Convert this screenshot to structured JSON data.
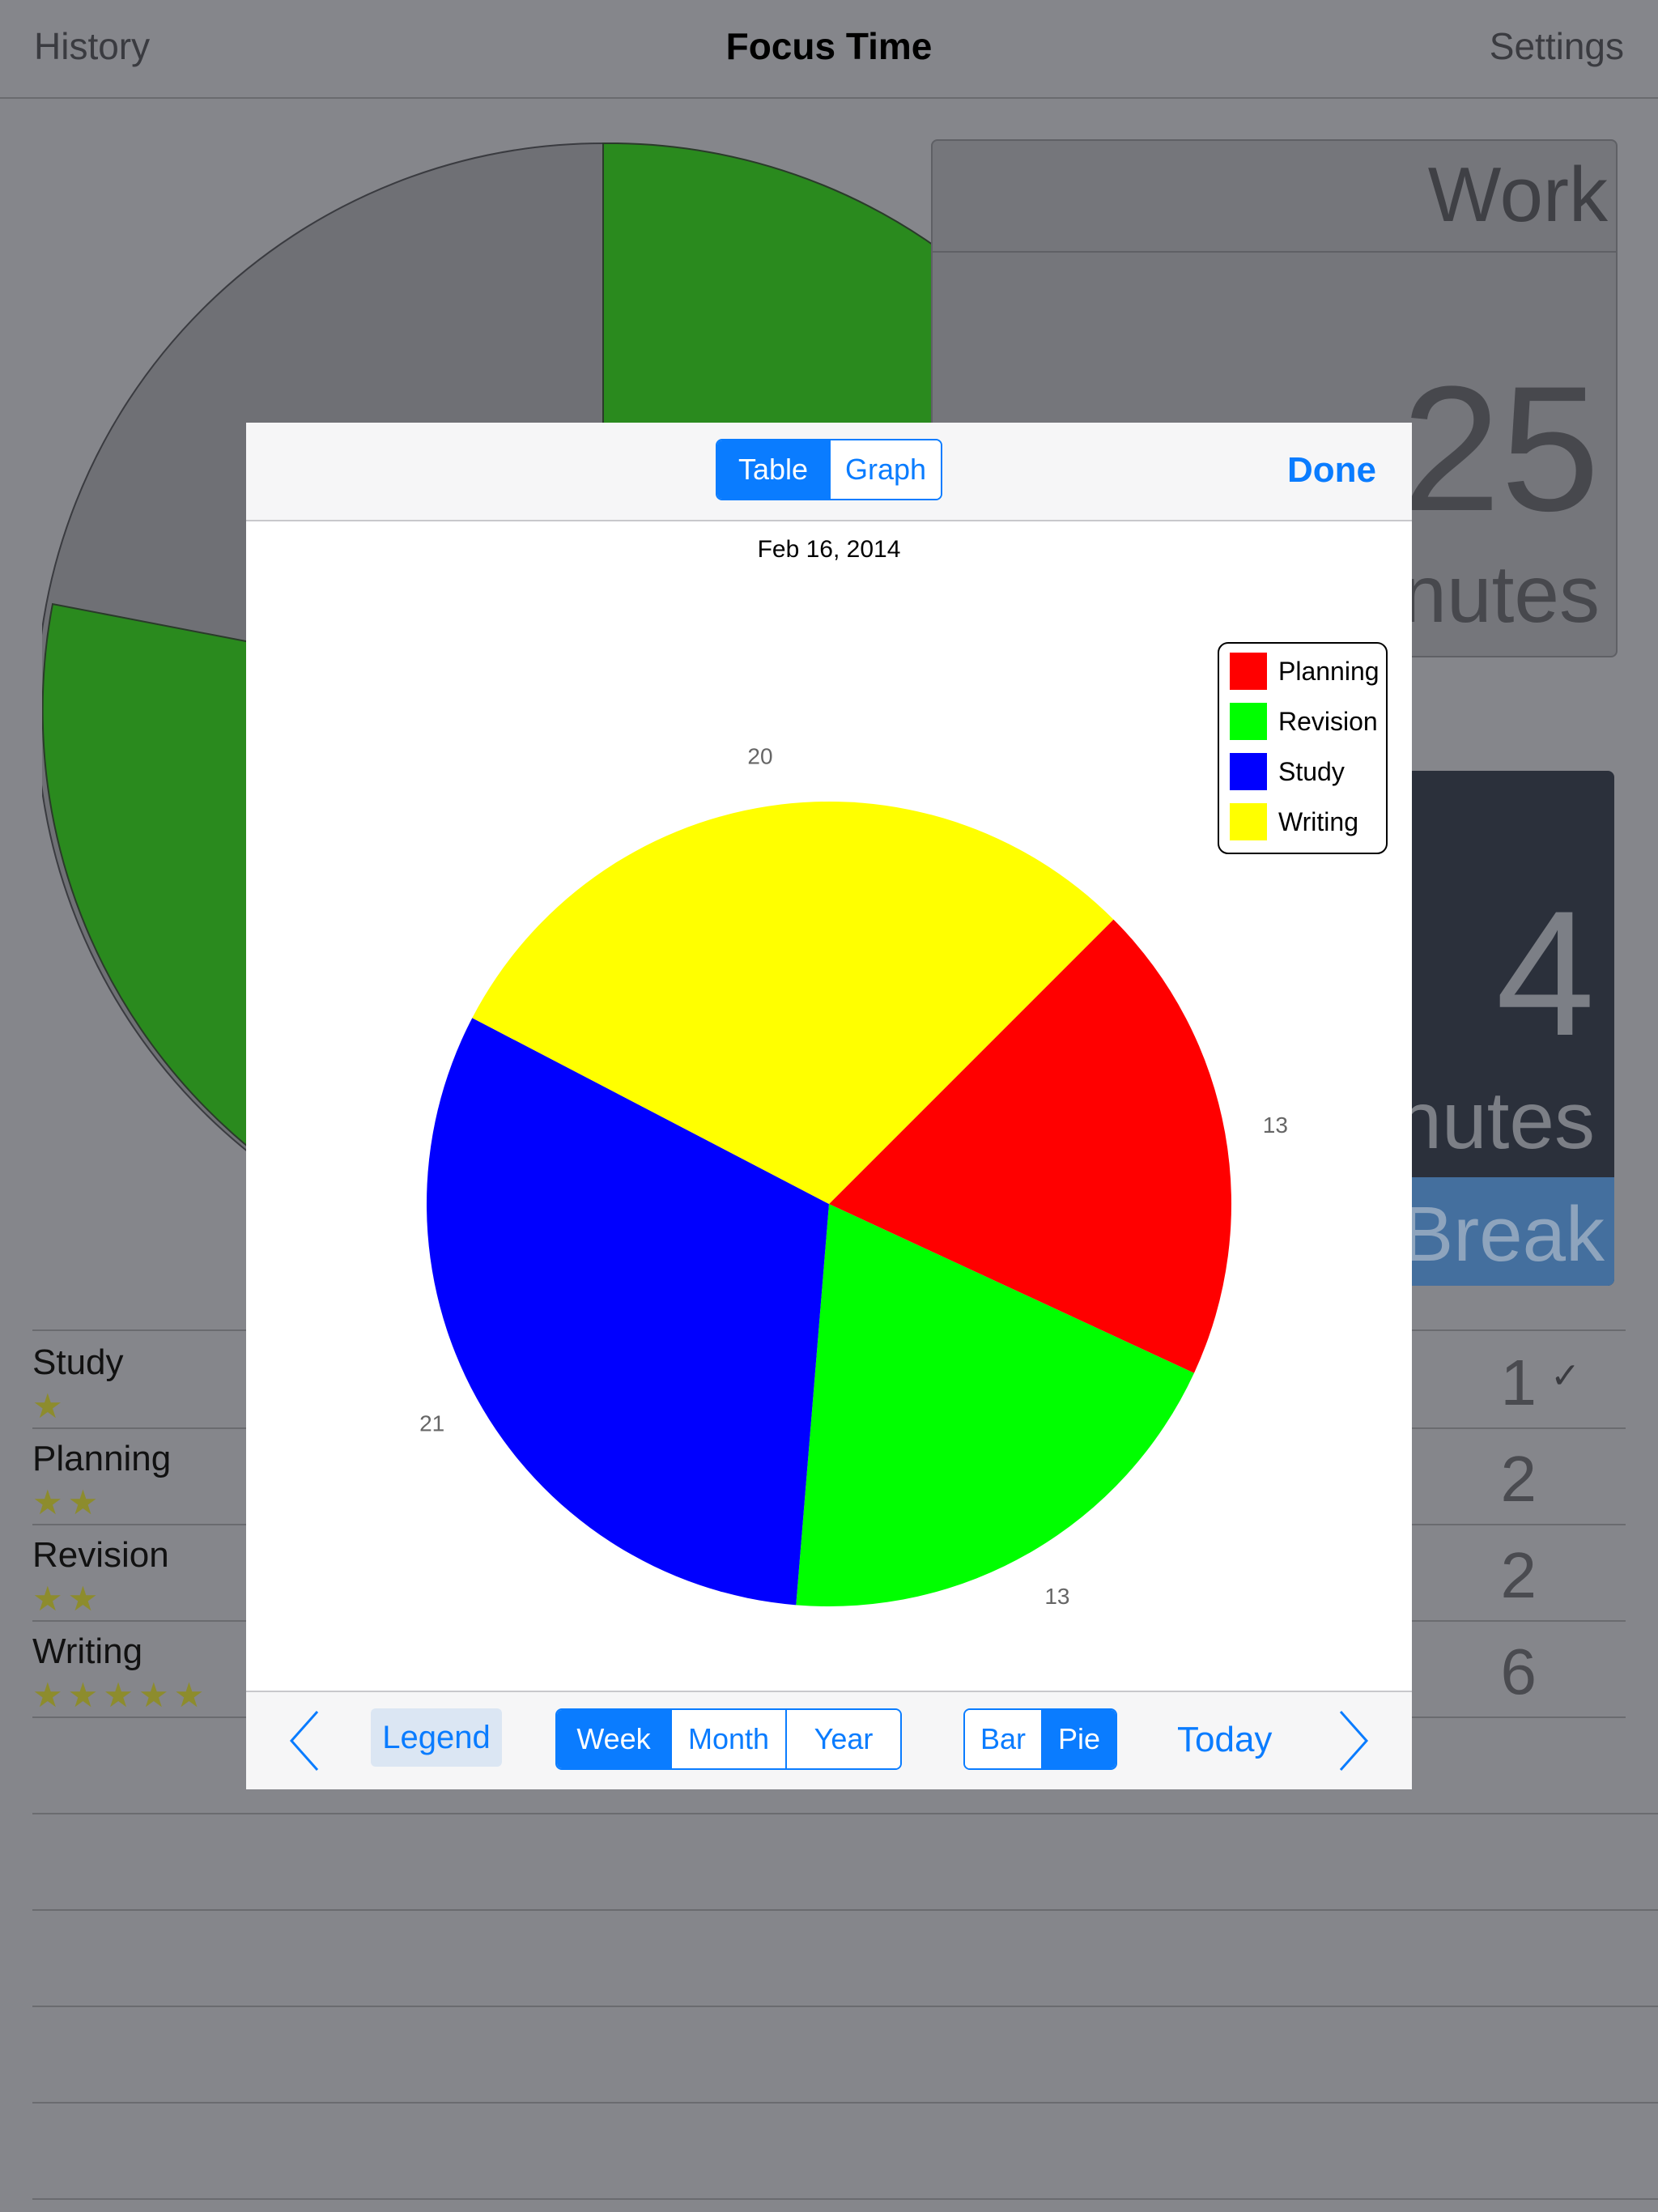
{
  "nav": {
    "left": "History",
    "title": "Focus Time",
    "right": "Settings"
  },
  "work": {
    "label": "Work",
    "value": "25",
    "unit": "nutes"
  },
  "break_card": {
    "value": "4",
    "unit": "nutes",
    "button": "Break"
  },
  "tasks": [
    {
      "name": "Study",
      "stars": "★",
      "count": "1",
      "check": "✓"
    },
    {
      "name": "Planning",
      "stars": "★★",
      "count": "2",
      "check": ""
    },
    {
      "name": "Revision",
      "stars": "★★",
      "count": "2",
      "check": ""
    },
    {
      "name": "Writing",
      "stars": "★★★★★",
      "count": "6",
      "check": ""
    }
  ],
  "modal": {
    "view_toggle": {
      "table": "Table",
      "graph": "Graph",
      "selected": "Table"
    },
    "done": "Done",
    "bottom": {
      "legend": "Legend",
      "range": {
        "week": "Week",
        "month": "Month",
        "year": "Year",
        "selected": "Week"
      },
      "type": {
        "bar": "Bar",
        "pie": "Pie",
        "selected": "Pie"
      },
      "today": "Today"
    }
  },
  "colors": {
    "accent": "#0a7cff",
    "bg_pie_green": "#2a8a1e",
    "bg_pie_gray": "#6f7075"
  },
  "chart_data": {
    "type": "pie",
    "title": "Feb 16, 2014",
    "series": [
      {
        "name": "Planning",
        "value": 13,
        "color": "#ff0000"
      },
      {
        "name": "Revision",
        "value": 13,
        "color": "#00ff00"
      },
      {
        "name": "Study",
        "value": 21,
        "color": "#0000ff"
      },
      {
        "name": "Writing",
        "value": 20,
        "color": "#ffff00"
      }
    ],
    "legend_position": "top-right"
  }
}
